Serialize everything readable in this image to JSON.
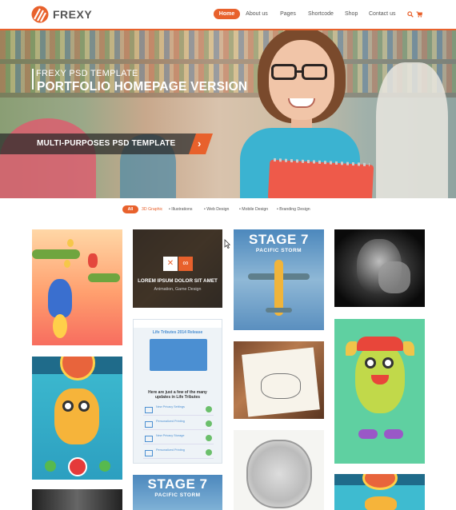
{
  "brand": {
    "name": "FREXY",
    "accent": "#e8612c"
  },
  "nav": {
    "items": [
      {
        "label": "Home",
        "active": true
      },
      {
        "label": "About us"
      },
      {
        "label": "Pages"
      },
      {
        "label": "Shortcode"
      },
      {
        "label": "Shop"
      },
      {
        "label": "Contact us"
      }
    ],
    "icons": [
      "search-icon",
      "cart-icon"
    ]
  },
  "hero": {
    "subtitle": "FREXY PSD TEMPLATE",
    "title": "PORTFOLIO HOMEPAGE VERSION",
    "band": "MULTI-PURPOSES PSD TEMPLATE",
    "arrow": "›",
    "prev": "‹",
    "next": "›"
  },
  "filters": [
    {
      "label": "All",
      "active": true
    },
    {
      "label": "3D Graphic",
      "highlight": true
    },
    {
      "label": "Illustrations"
    },
    {
      "label": "Web Design"
    },
    {
      "label": "Mobile Design"
    },
    {
      "label": "Branding Design"
    }
  ],
  "portfolio": {
    "overlay_title": "LOREM IPSUM DOLOR SIT AMET",
    "overlay_sub": "Animation, Game Design",
    "stage_title": "STAGE 7",
    "stage_sub": "PACIFIC STORM",
    "newsletter_title": "Life Tributes 2014 Release",
    "newsletter_text": "Here are just a few of the many updates in Life Tributes",
    "newsletter_rows": [
      "New Privacy Settings",
      "Personalized Printing",
      "New Privacy Storage",
      "Personalized Printing"
    ]
  }
}
